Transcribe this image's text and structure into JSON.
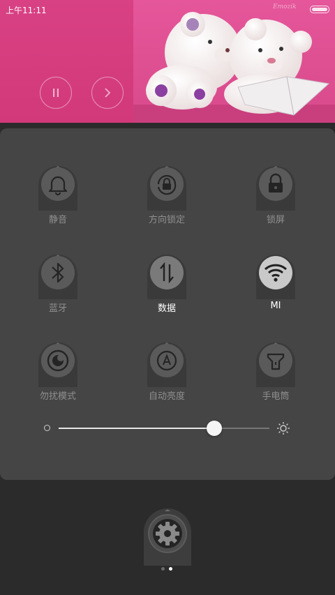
{
  "status_bar": {
    "time": "上午11:11"
  },
  "media": {
    "pause_label": "pause-icon",
    "next_label": "next-icon",
    "accent": "#d63a7e"
  },
  "toggles": [
    {
      "label": "静音",
      "icon": "bell-icon",
      "active": false
    },
    {
      "label": "方向锁定",
      "icon": "rotation-lock-icon",
      "active": false
    },
    {
      "label": "锁屏",
      "icon": "padlock-icon",
      "active": false
    },
    {
      "label": "蓝牙",
      "icon": "bluetooth-icon",
      "active": false
    },
    {
      "label": "数据",
      "icon": "mobile-data-icon",
      "active": true
    },
    {
      "label": "MI",
      "icon": "wifi-icon",
      "active": true
    },
    {
      "label": "勿扰模式",
      "icon": "do-not-disturb-icon",
      "active": false
    },
    {
      "label": "自动亮度",
      "icon": "auto-brightness-icon",
      "active": false
    },
    {
      "label": "手电筒",
      "icon": "flashlight-icon",
      "active": false
    }
  ],
  "brightness": {
    "level": 0.74
  },
  "pager": {
    "pages": 2,
    "current": 2
  }
}
